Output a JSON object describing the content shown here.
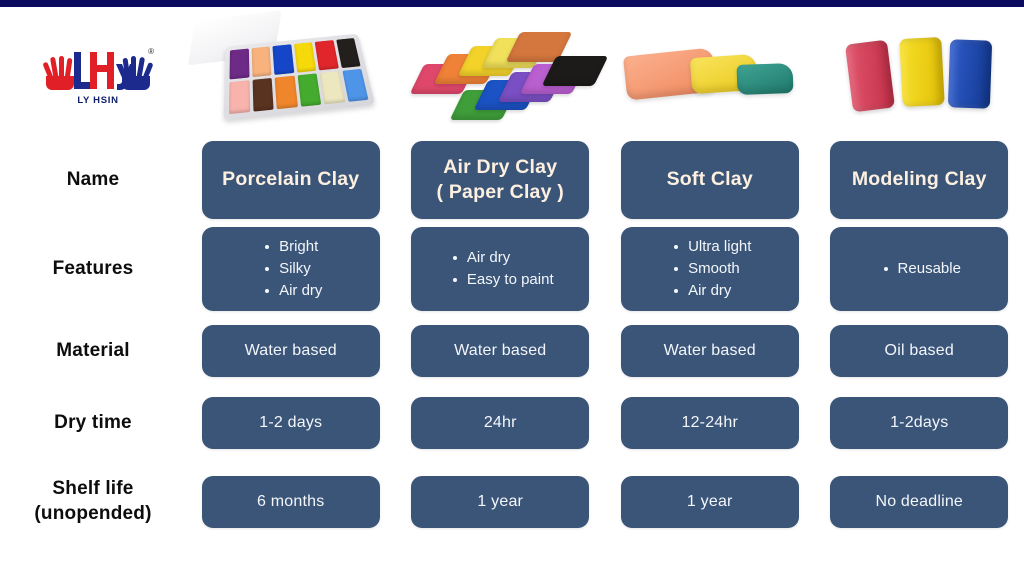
{
  "brand": {
    "logo_letters": "LH",
    "registered_symbol": "®",
    "caption": "LY HSIN"
  },
  "theme": {
    "top_bar": "#0a0a5e",
    "card_blue": "#3a5578",
    "name_text": "#fdf0e0",
    "body_text": "#f3f6fa",
    "label_text": "#0d0d0d",
    "background": "#ffffff"
  },
  "row_labels": [
    {
      "text": "Name"
    },
    {
      "text": "Features"
    },
    {
      "text": "Material"
    },
    {
      "text": "Dry time"
    },
    {
      "text": "Shelf life",
      "text2": "(unopended)"
    }
  ],
  "products": [
    {
      "photo_name": "porcelain-clay-tray-photo",
      "name": "Porcelain Clay",
      "features": [
        "Bright",
        "Silky",
        "Air dry"
      ],
      "material": "Water based",
      "dry_time": "1-2 days",
      "shelf_life": "6 months",
      "photo_colors": [
        "#6d2a86",
        "#f7b27e",
        "#1546c8",
        "#f5d90a",
        "#e0262b",
        "#231f1c",
        "#f8b3ad",
        "#5a3220",
        "#f0862c",
        "#45ab2e",
        "#ede7c0",
        "#4e95e8"
      ]
    },
    {
      "photo_name": "air-dry-clay-blocks-photo",
      "name": "Air Dry Clay",
      "name2": "( Paper Clay )",
      "features": [
        "Air dry",
        "Easy to paint"
      ],
      "material": "Water based",
      "dry_time": "24hr",
      "shelf_life": "1 year",
      "photo_colors": [
        "#e0486b",
        "#ef8236",
        "#f3d32a",
        "#f0e05a",
        "#d4773e",
        "#3f9e3a",
        "#1b52c4",
        "#7b4fc4",
        "#b95fd0",
        "#1d1a1a"
      ]
    },
    {
      "photo_name": "soft-clay-slabs-photo",
      "name": "Soft Clay",
      "features": [
        "Ultra light",
        "Smooth",
        "Air dry"
      ],
      "material": "Water based",
      "dry_time": "12-24hr",
      "shelf_life": "1 year",
      "photo_colors": [
        "#f79b72",
        "#f4dc2c",
        "#2f8f80"
      ]
    },
    {
      "photo_name": "modeling-clay-bars-photo",
      "name": "Modeling Clay",
      "features": [
        "Reusable"
      ],
      "material": "Oil based",
      "dry_time": "1-2days",
      "shelf_life": "No deadline",
      "photo_colors": [
        "#d6415a",
        "#f3d412",
        "#1f49b5"
      ]
    }
  ]
}
